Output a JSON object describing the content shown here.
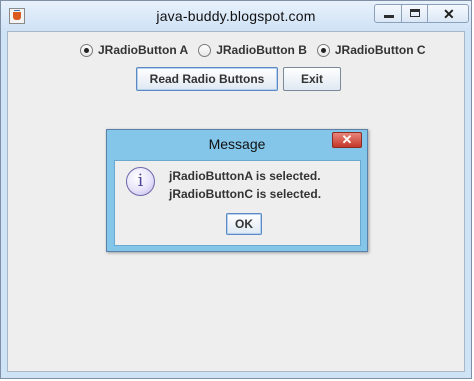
{
  "window": {
    "title": "java-buddy.blogspot.com",
    "controls": {
      "minimize": "",
      "maximize": "",
      "close": "✕"
    }
  },
  "radios": [
    {
      "label": "JRadioButton A",
      "checked": true
    },
    {
      "label": "JRadioButton B",
      "checked": false
    },
    {
      "label": "JRadioButton C",
      "checked": true
    }
  ],
  "buttons": {
    "read": "Read Radio Buttons",
    "exit": "Exit"
  },
  "dialog": {
    "title": "Message",
    "close": "✕",
    "icon": "i",
    "lines": [
      "jRadioButtonA is selected.",
      "jRadioButtonC is selected."
    ],
    "ok": "OK"
  }
}
